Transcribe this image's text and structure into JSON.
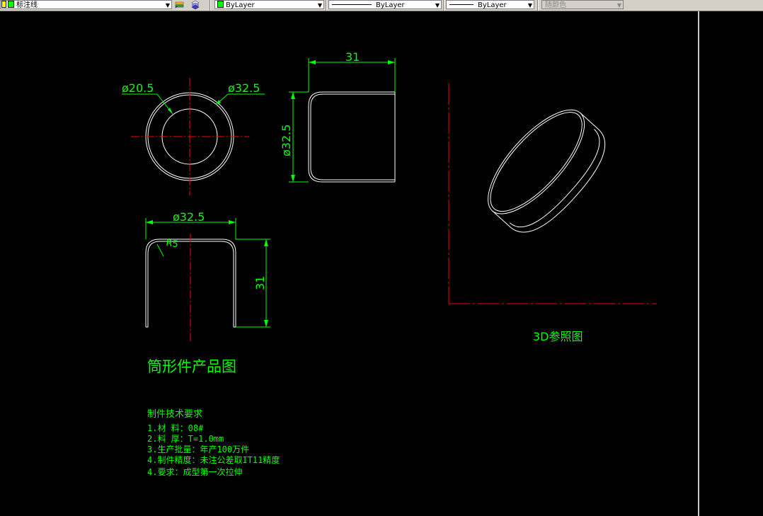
{
  "toolbar": {
    "layer_combo": "标注线",
    "color_combo": "ByLayer",
    "linetype_combo": "ByLayer",
    "lineweight_combo": "ByLayer",
    "plotstyle_combo": "随颜色"
  },
  "drawing": {
    "top_view": {
      "dim_inner": "ø20.5",
      "dim_outer": "ø32.5"
    },
    "side_view": {
      "dim_width": "31",
      "dim_height": "ø32.5"
    },
    "front_view": {
      "dim_width": "ø32.5",
      "dim_radius": "R5",
      "dim_height": "31"
    },
    "iso_label": "3D参照图",
    "title": "筒形件产品图",
    "requirements": {
      "heading": "制件技术要求",
      "items": [
        "1.材    料：08#",
        "2.料    厚：T=1.0mm",
        "3.生产批量：年产100万件",
        "4.制件精度：未注公差取IT11精度",
        "4.要求：成型第一次拉伸"
      ]
    }
  },
  "colors": {
    "background": "#000000",
    "geometry": "#ffffff",
    "dimension": "#00ff00",
    "centerline": "#ff0000"
  }
}
